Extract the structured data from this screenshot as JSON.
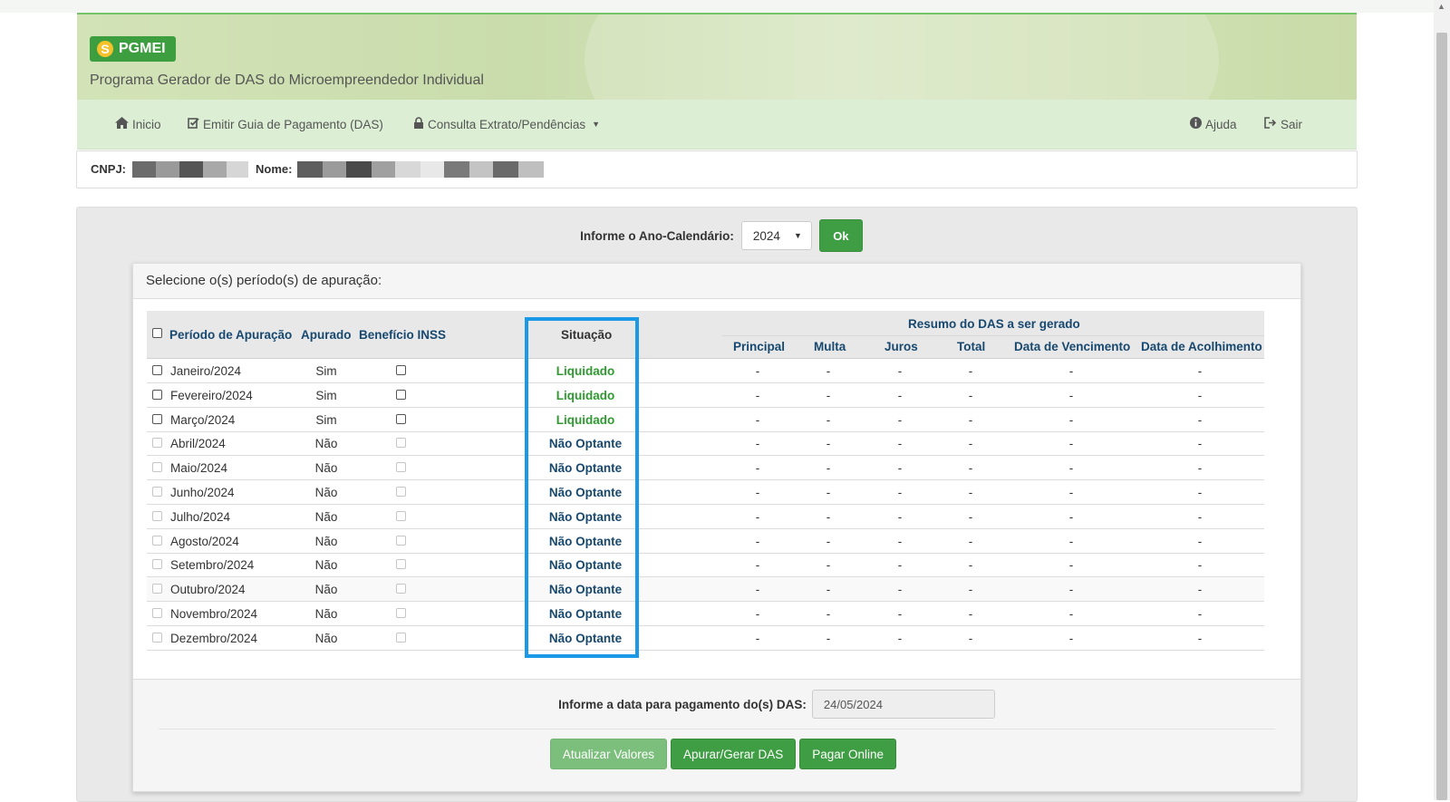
{
  "app": {
    "logo_text": "PGMEI",
    "subtitle": "Programa Gerador de DAS do Microempreendedor Individual"
  },
  "nav": {
    "inicio": "Inicio",
    "emitir": "Emitir Guia de Pagamento (DAS)",
    "consulta": "Consulta Extrato/Pendências",
    "ajuda": "Ajuda",
    "sair": "Sair"
  },
  "identity": {
    "cnpj_label": "CNPJ:",
    "nome_label": "Nome:"
  },
  "year": {
    "label": "Informe o Ano-Calendário:",
    "selected": "2024",
    "ok_label": "Ok"
  },
  "card_title": "Selecione o(s) período(s) de apuração:",
  "table": {
    "headers": {
      "periodo": "Período de Apuração",
      "apurado": "Apurado",
      "beneficio": "Benefício INSS",
      "situacao": "Situação",
      "resumo": "Resumo do DAS a ser gerado",
      "principal": "Principal",
      "multa": "Multa",
      "juros": "Juros",
      "total": "Total",
      "vencimento": "Data de Vencimento",
      "acolhimento": "Data de Acolhimento"
    },
    "rows": [
      {
        "periodo": "Janeiro/2024",
        "apurado": "Sim",
        "situacao": "Liquidado",
        "principal": "-",
        "multa": "-",
        "juros": "-",
        "total": "-",
        "vencimento": "-",
        "acolhimento": "-"
      },
      {
        "periodo": "Fevereiro/2024",
        "apurado": "Sim",
        "situacao": "Liquidado",
        "principal": "-",
        "multa": "-",
        "juros": "-",
        "total": "-",
        "vencimento": "-",
        "acolhimento": "-"
      },
      {
        "periodo": "Março/2024",
        "apurado": "Sim",
        "situacao": "Liquidado",
        "principal": "-",
        "multa": "-",
        "juros": "-",
        "total": "-",
        "vencimento": "-",
        "acolhimento": "-"
      },
      {
        "periodo": "Abril/2024",
        "apurado": "Não",
        "situacao": "Não Optante",
        "principal": "-",
        "multa": "-",
        "juros": "-",
        "total": "-",
        "vencimento": "-",
        "acolhimento": "-"
      },
      {
        "periodo": "Maio/2024",
        "apurado": "Não",
        "situacao": "Não Optante",
        "principal": "-",
        "multa": "-",
        "juros": "-",
        "total": "-",
        "vencimento": "-",
        "acolhimento": "-"
      },
      {
        "periodo": "Junho/2024",
        "apurado": "Não",
        "situacao": "Não Optante",
        "principal": "-",
        "multa": "-",
        "juros": "-",
        "total": "-",
        "vencimento": "-",
        "acolhimento": "-"
      },
      {
        "periodo": "Julho/2024",
        "apurado": "Não",
        "situacao": "Não Optante",
        "principal": "-",
        "multa": "-",
        "juros": "-",
        "total": "-",
        "vencimento": "-",
        "acolhimento": "-"
      },
      {
        "periodo": "Agosto/2024",
        "apurado": "Não",
        "situacao": "Não Optante",
        "principal": "-",
        "multa": "-",
        "juros": "-",
        "total": "-",
        "vencimento": "-",
        "acolhimento": "-"
      },
      {
        "periodo": "Setembro/2024",
        "apurado": "Não",
        "situacao": "Não Optante",
        "principal": "-",
        "multa": "-",
        "juros": "-",
        "total": "-",
        "vencimento": "-",
        "acolhimento": "-"
      },
      {
        "periodo": "Outubro/2024",
        "apurado": "Não",
        "situacao": "Não Optante",
        "principal": "-",
        "multa": "-",
        "juros": "-",
        "total": "-",
        "vencimento": "-",
        "acolhimento": "-"
      },
      {
        "periodo": "Novembro/2024",
        "apurado": "Não",
        "situacao": "Não Optante",
        "principal": "-",
        "multa": "-",
        "juros": "-",
        "total": "-",
        "vencimento": "-",
        "acolhimento": "-"
      },
      {
        "periodo": "Dezembro/2024",
        "apurado": "Não",
        "situacao": "Não Optante",
        "principal": "-",
        "multa": "-",
        "juros": "-",
        "total": "-",
        "vencimento": "-",
        "acolhimento": "-"
      }
    ]
  },
  "payment": {
    "label": "Informe a data para pagamento do(s) DAS:",
    "date_value": "24/05/2024"
  },
  "buttons": {
    "atualizar": "Atualizar Valores",
    "apurar": "Apurar/Gerar DAS",
    "pagar": "Pagar Online"
  },
  "colors": {
    "liquidado": "#2e9a2f",
    "nao_optante": "#17486f",
    "highlight": "#1a9ae6",
    "brand_green": "#3f9e43"
  },
  "icons": {
    "inicio": "home-icon",
    "emitir": "edit-check-icon",
    "consulta": "lock-icon",
    "ajuda": "info-circle-icon",
    "sair": "sign-out-icon",
    "logo": "s-logo-icon"
  }
}
